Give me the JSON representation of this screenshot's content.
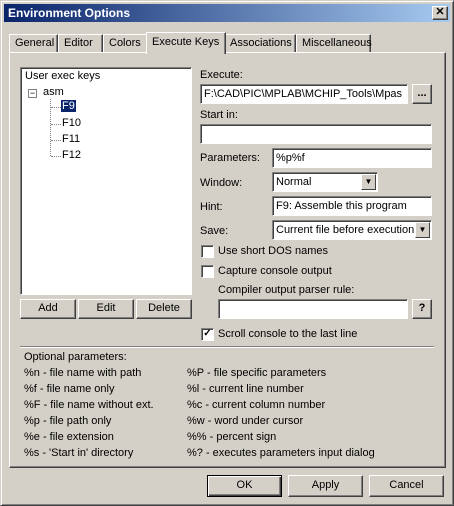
{
  "window": {
    "title": "Environment Options",
    "close_glyph": "✕"
  },
  "tabs": [
    {
      "label": "General"
    },
    {
      "label": "Editor"
    },
    {
      "label": "Colors"
    },
    {
      "label": "Execute Keys",
      "active": true
    },
    {
      "label": "Associations"
    },
    {
      "label": "Miscellaneous"
    }
  ],
  "tree": {
    "root": "User exec keys",
    "group": "asm",
    "expander": "−",
    "items": [
      "F9",
      "F10",
      "F11",
      "F12"
    ],
    "selected_index": 0
  },
  "tree_buttons": {
    "add": "Add",
    "edit": "Edit",
    "delete": "Delete"
  },
  "form": {
    "execute_label": "Execute:",
    "execute_value": "F:\\CAD\\PIC\\MPLAB\\MCHIP_Tools\\Mpas",
    "browse_label": "...",
    "start_in_label": "Start in:",
    "start_in_value": "",
    "parameters_label": "Parameters:",
    "parameters_value": "%p%f",
    "window_label": "Window:",
    "window_value": "Normal",
    "hint_label": "Hint:",
    "hint_value": "F9: Assemble this program",
    "save_label": "Save:",
    "save_value": "Current file before execution",
    "short_dos_label": "Use short DOS names",
    "short_dos_checked": false,
    "capture_label": "Capture console output",
    "capture_checked": false,
    "parser_rule_label": "Compiler output parser rule:",
    "parser_rule_value": "",
    "parser_help_label": "?",
    "scroll_label": "Scroll console to the last line",
    "scroll_checked": true,
    "check_glyph": "✓",
    "arrow_glyph": "▼"
  },
  "optional": {
    "header": "Optional parameters:",
    "left": [
      "%n  - file name with path",
      "%f   - file name only",
      "%F  - file name without ext.",
      "%p  - file path only",
      "%e  - file extension",
      "%s  - 'Start in' directory"
    ],
    "right": [
      "%P  - file specific parameters",
      "%l    - current line number",
      "%c   - current column number",
      "%w  - word under cursor",
      "%%  - percent sign",
      "%?  - executes parameters input dialog"
    ]
  },
  "footer": {
    "ok": "OK",
    "apply": "Apply",
    "cancel": "Cancel"
  }
}
